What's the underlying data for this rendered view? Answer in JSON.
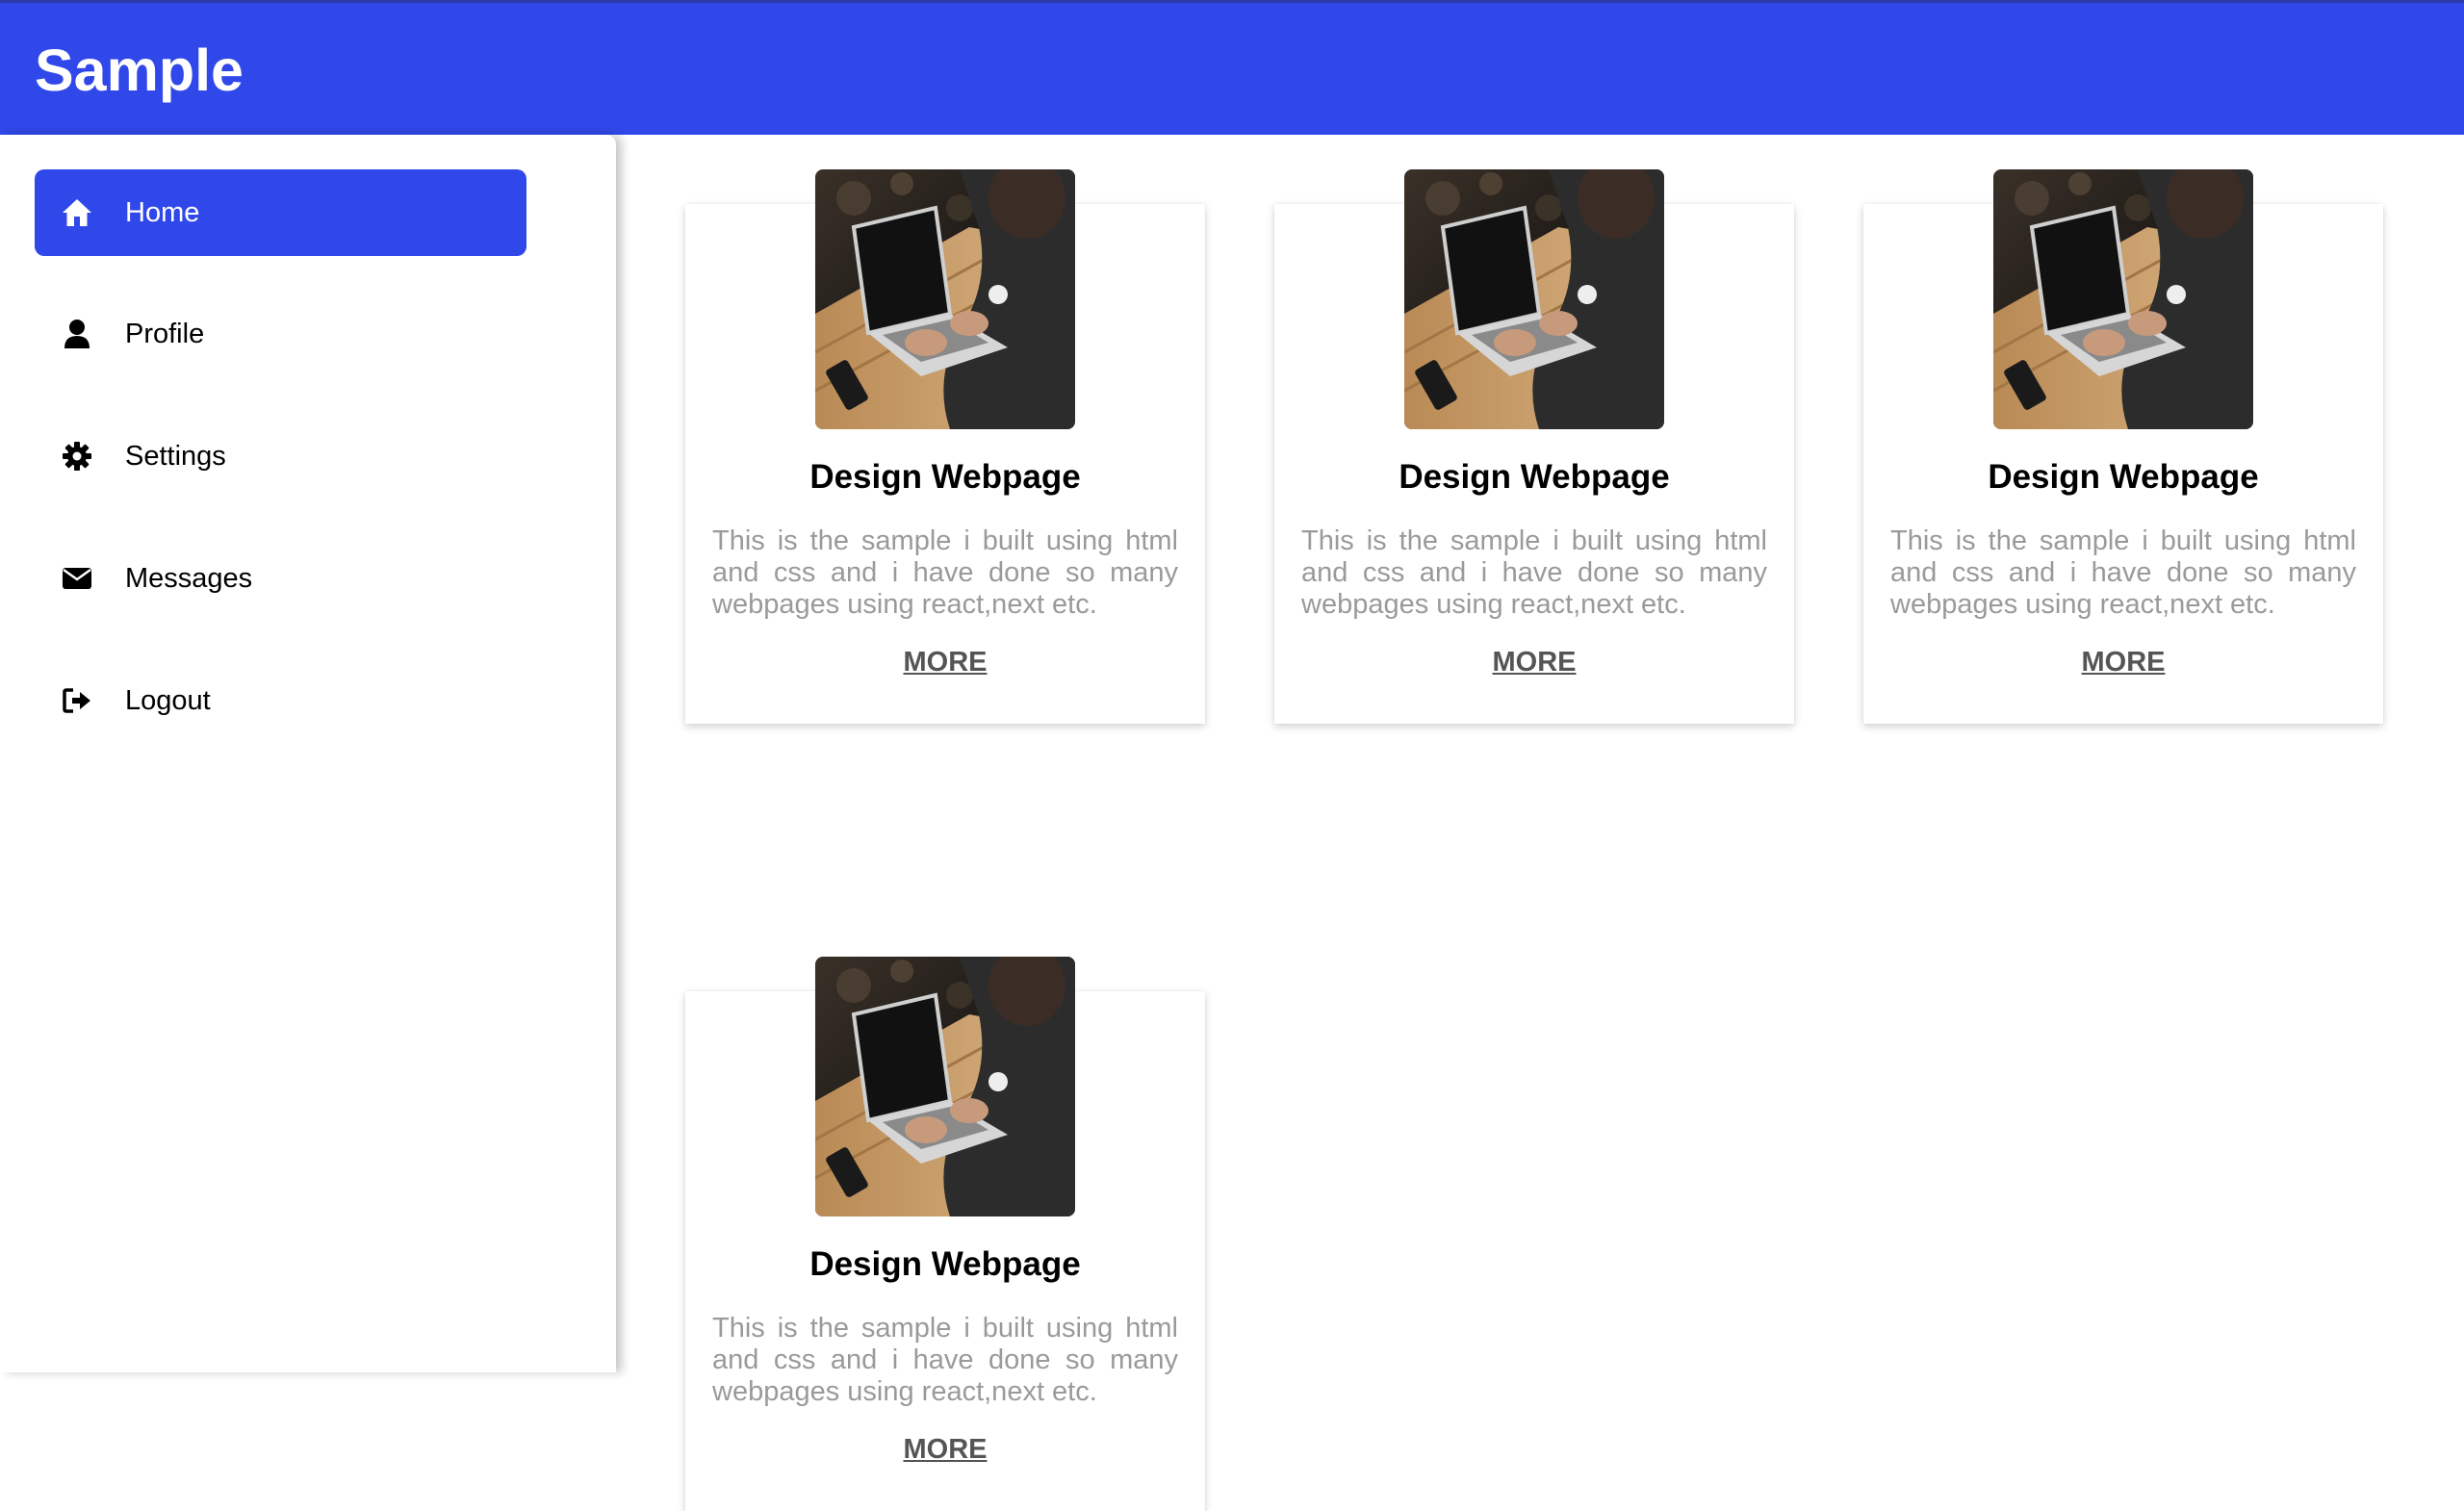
{
  "header": {
    "brand": "Sample",
    "background_color": "#3048ea"
  },
  "sidebar": {
    "items": [
      {
        "label": "Home",
        "icon": "home-icon",
        "active": true
      },
      {
        "label": "Profile",
        "icon": "user-icon",
        "active": false
      },
      {
        "label": "Settings",
        "icon": "gear-icon",
        "active": false
      },
      {
        "label": "Messages",
        "icon": "envelope-icon",
        "active": false
      },
      {
        "label": "Logout",
        "icon": "logout-icon",
        "active": false
      }
    ],
    "active_color": "#3048ea"
  },
  "cards": [
    {
      "image": "laptop-photo",
      "title": "Design Webpage",
      "description": "This is the sample i built using html and css and i have done so many webpages using react,next etc.",
      "link_label": "MORE"
    },
    {
      "image": "laptop-photo",
      "title": "Design Webpage",
      "description": "This is the sample i built using html and css and i have done so many webpages using react,next etc.",
      "link_label": "MORE"
    },
    {
      "image": "laptop-photo",
      "title": "Design Webpage",
      "description": "This is the sample i built using html and css and i have done so many webpages using react,next etc.",
      "link_label": "MORE"
    },
    {
      "image": "laptop-photo",
      "title": "Design Webpage",
      "description": "This is the sample i built using html and css and i have done so many webpages using react,next etc.",
      "link_label": "MORE"
    }
  ]
}
